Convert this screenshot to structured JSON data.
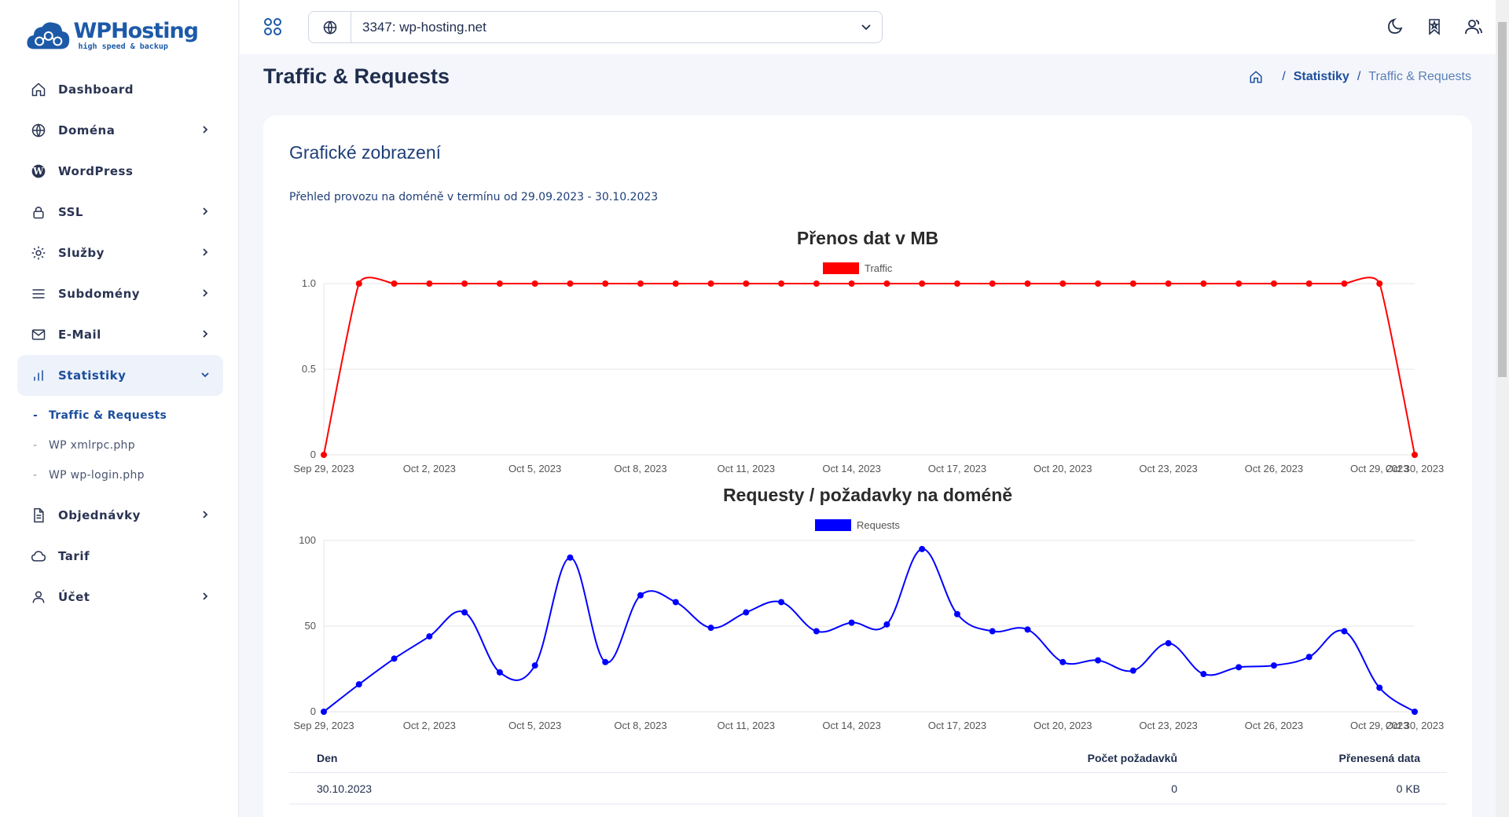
{
  "logo": {
    "title": "WPHosting",
    "subtitle": "high speed & backup"
  },
  "sidebar": {
    "items": [
      {
        "label": "Dashboard",
        "icon": "home-icon",
        "chevron": false
      },
      {
        "label": "Doména",
        "icon": "globe-icon",
        "chevron": true
      },
      {
        "label": "WordPress",
        "icon": "wordpress-icon",
        "chevron": false
      },
      {
        "label": "SSL",
        "icon": "lock-icon",
        "chevron": true
      },
      {
        "label": "Služby",
        "icon": "gear-icon",
        "chevron": true
      },
      {
        "label": "Subdomény",
        "icon": "menu-icon",
        "chevron": true
      },
      {
        "label": "E-Mail",
        "icon": "mail-icon",
        "chevron": true
      },
      {
        "label": "Statistiky",
        "icon": "bar-chart-icon",
        "chevron": true,
        "active": true
      }
    ],
    "sub_items": [
      {
        "label": "Traffic & Requests",
        "current": true
      },
      {
        "label": "WP xmlrpc.php",
        "current": false
      },
      {
        "label": "WP wp-login.php",
        "current": false
      }
    ],
    "items_after": [
      {
        "label": "Objednávky",
        "icon": "document-icon",
        "chevron": true
      },
      {
        "label": "Tarif",
        "icon": "cloud-icon",
        "chevron": false
      },
      {
        "label": "Účet",
        "icon": "user-icon",
        "chevron": true
      }
    ]
  },
  "topbar": {
    "site_value": "3347: wp-hosting.net"
  },
  "page": {
    "title": "Traffic & Requests",
    "breadcrumb": {
      "sep": "/",
      "parent": "Statistiky",
      "current": "Traffic & Requests"
    }
  },
  "card": {
    "title": "Grafické zobrazení",
    "description": "Přehled provozu na doméně v termínu od 29.09.2023 - 30.10.2023"
  },
  "colors": {
    "traffic": "#ff0000",
    "requests": "#0000ff",
    "accent": "#1c4e9b"
  },
  "chart_data": [
    {
      "type": "line",
      "title": "Přenos dat v MB",
      "x_ticks": [
        "Sep 29, 2023",
        "Oct 2, 2023",
        "Oct 5, 2023",
        "Oct 8, 2023",
        "Oct 11, 2023",
        "Oct 14, 2023",
        "Oct 17, 2023",
        "Oct 20, 2023",
        "Oct 23, 2023",
        "Oct 26, 2023",
        "Oct 29, 2023",
        "Oct 30, 2023"
      ],
      "y_ticks": [
        "1.0",
        "0.5",
        "0"
      ],
      "ylim": [
        0,
        1
      ],
      "series": [
        {
          "name": "Traffic",
          "color": "#ff0000",
          "values": [
            0,
            1,
            1,
            1,
            1,
            1,
            1,
            1,
            1,
            1,
            1,
            1,
            1,
            1,
            1,
            1,
            1,
            1,
            1,
            1,
            1,
            1,
            1,
            1,
            1,
            1,
            1,
            1,
            1,
            1,
            1,
            0
          ]
        }
      ]
    },
    {
      "type": "line",
      "title": "Requesty / požadavky na doméně",
      "x_ticks": [
        "Sep 29, 2023",
        "Oct 2, 2023",
        "Oct 5, 2023",
        "Oct 8, 2023",
        "Oct 11, 2023",
        "Oct 14, 2023",
        "Oct 17, 2023",
        "Oct 20, 2023",
        "Oct 23, 2023",
        "Oct 26, 2023",
        "Oct 29, 2023",
        "Oct 30, 2023"
      ],
      "y_ticks": [
        "100",
        "50",
        "0"
      ],
      "ylim": [
        0,
        100
      ],
      "series": [
        {
          "name": "Requests",
          "color": "#0000ff",
          "values": [
            0,
            16,
            31,
            44,
            58,
            23,
            27,
            90,
            29,
            68,
            64,
            49,
            58,
            64,
            47,
            52,
            51,
            95,
            57,
            47,
            48,
            29,
            30,
            24,
            40,
            22,
            26,
            27,
            32,
            47,
            14,
            0
          ]
        }
      ]
    }
  ],
  "table": {
    "headers": [
      "Den",
      "Počet požadavků",
      "Přenesená data"
    ],
    "rows": [
      [
        "30.10.2023",
        "0",
        "0 KB"
      ]
    ]
  }
}
